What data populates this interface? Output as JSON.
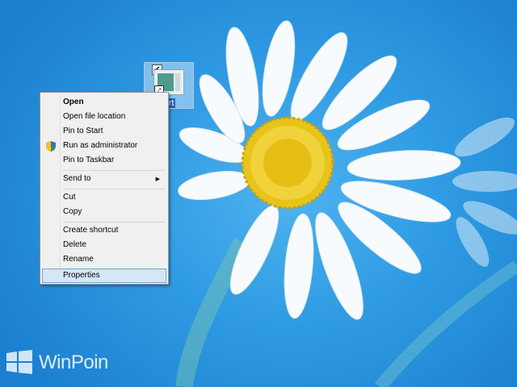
{
  "desktop": {
    "shortcut_label": "ort"
  },
  "context_menu": {
    "items": [
      {
        "label": "Open"
      },
      {
        "label": "Open file location"
      },
      {
        "label": "Pin to Start"
      },
      {
        "label": "Run as administrator",
        "icon": "uac-shield-icon"
      },
      {
        "label": "Pin to Taskbar"
      },
      {
        "label": "Send to",
        "submenu": true
      },
      {
        "label": "Cut"
      },
      {
        "label": "Copy"
      },
      {
        "label": "Create shortcut"
      },
      {
        "label": "Delete"
      },
      {
        "label": "Rename"
      },
      {
        "label": "Properties",
        "highlighted": true
      }
    ],
    "submenu_arrow": "▶"
  },
  "watermark": {
    "text": "WinPoin"
  },
  "colors": {
    "wallpaper": "#2f9be3",
    "menu_bg": "#f0f0f0",
    "menu_highlight": "#d5e6f6",
    "flower_center": "#e8c31a"
  }
}
